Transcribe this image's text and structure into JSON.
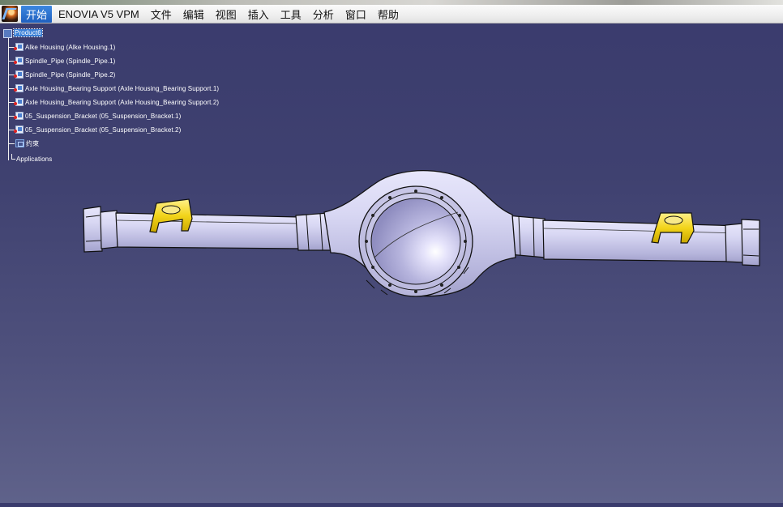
{
  "menubar": {
    "items": [
      {
        "label": "开始",
        "active": true
      },
      {
        "label": "ENOVIA V5 VPM",
        "active": false
      },
      {
        "label": "文件",
        "active": false
      },
      {
        "label": "编辑",
        "active": false
      },
      {
        "label": "视图",
        "active": false
      },
      {
        "label": "插入",
        "active": false
      },
      {
        "label": "工具",
        "active": false
      },
      {
        "label": "分析",
        "active": false
      },
      {
        "label": "窗口",
        "active": false
      },
      {
        "label": "帮助",
        "active": false
      }
    ]
  },
  "tree": {
    "root": {
      "label": "Product6",
      "icon": "product-icon"
    },
    "children": [
      {
        "label": "Alke Housing (Alke Housing.1)",
        "icon": "part-icon"
      },
      {
        "label": "Spindle_Pipe (Spindle_Pipe.1)",
        "icon": "part-icon"
      },
      {
        "label": "Spindle_Pipe (Spindle_Pipe.2)",
        "icon": "part-icon"
      },
      {
        "label": "Axle Housing_Bearing Support (Axle Housing_Bearing Support.1)",
        "icon": "part-icon"
      },
      {
        "label": "Axle Housing_Bearing Support (Axle Housing_Bearing Support.2)",
        "icon": "part-icon"
      },
      {
        "label": "05_Suspension_Bracket (05_Suspension_Bracket.1)",
        "icon": "part-icon"
      },
      {
        "label": "05_Suspension_Bracket (05_Suspension_Bracket.2)",
        "icon": "part-icon"
      }
    ],
    "constraints": {
      "label": "约束",
      "icon": "constraints-icon"
    },
    "applications": {
      "label": "Applications"
    }
  },
  "colors": {
    "background_top": "#3a3b6d",
    "background_bottom": "#5f628a",
    "model_body": "#c9c8ea",
    "bracket": "#f2d41a",
    "menu_active": "#2a6fd0"
  }
}
